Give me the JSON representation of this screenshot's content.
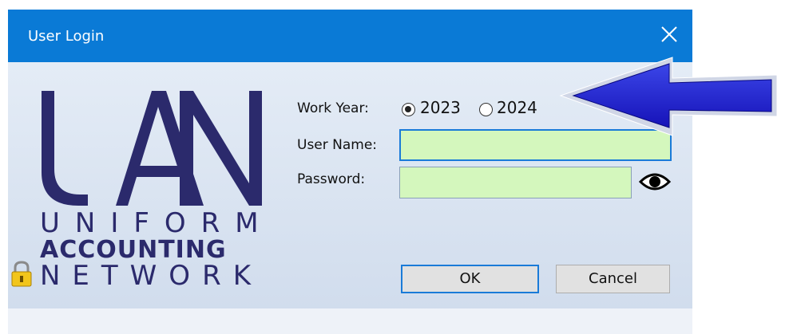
{
  "window": {
    "title": "User Login"
  },
  "logo": {
    "line1": "UNIFORM",
    "line2": "ACCOUNTING",
    "line3": "NETWORK"
  },
  "form": {
    "work_year_label": "Work Year:",
    "years": [
      {
        "label": "2023",
        "selected": true
      },
      {
        "label": "2024",
        "selected": false
      }
    ],
    "username_label": "User Name:",
    "username_value": "",
    "password_label": "Password:",
    "password_value": ""
  },
  "buttons": {
    "ok": "OK",
    "cancel": "Cancel"
  },
  "colors": {
    "titlebar": "#0a7ad6",
    "field_bg": "#d4f7bd",
    "logo": "#2b2a6c",
    "arrow": "#1c1ccc"
  }
}
